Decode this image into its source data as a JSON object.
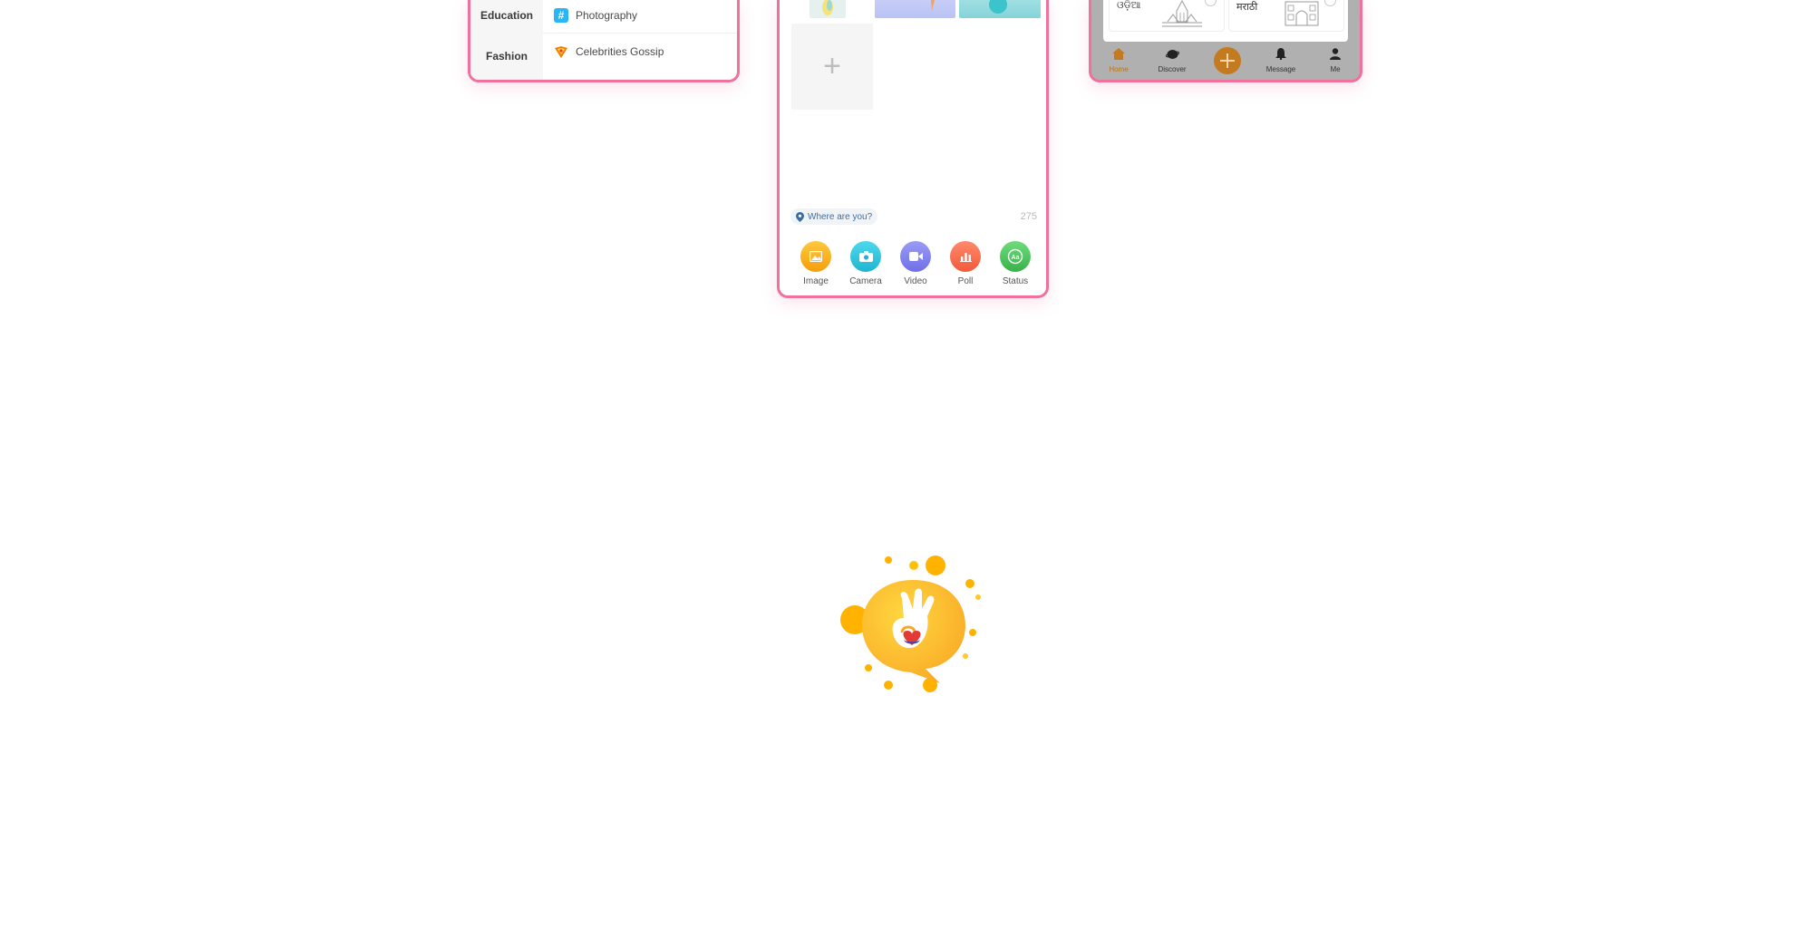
{
  "left_panel": {
    "categories": [
      {
        "label": "Education"
      },
      {
        "label": "Fashion"
      }
    ],
    "topics": [
      {
        "label": "Photography",
        "icon": "hashtag-icon"
      },
      {
        "label": "Celebrities Gossip",
        "icon": "gossip-icon"
      }
    ]
  },
  "composer": {
    "add_media_symbol": "+",
    "location_placeholder": "Where are you?",
    "char_count": "275",
    "tools": [
      {
        "label": "Image",
        "icon": "image-icon",
        "color": "#f9a825"
      },
      {
        "label": "Camera",
        "icon": "camera-icon",
        "color": "#26c6da"
      },
      {
        "label": "Video",
        "icon": "video-icon",
        "color": "#7e7ff0"
      },
      {
        "label": "Poll",
        "icon": "poll-icon",
        "color": "#f8684c"
      },
      {
        "label": "Status",
        "icon": "status-icon",
        "color": "#4cc35a"
      }
    ]
  },
  "language_panel": {
    "languages": [
      {
        "label": "ଓଡ଼ିଆ"
      },
      {
        "label": "मराठी"
      }
    ],
    "tabs": [
      {
        "label": "Home",
        "icon": "home-icon",
        "active": true
      },
      {
        "label": "Discover",
        "icon": "discover-icon",
        "active": false
      },
      {
        "label": "Message",
        "icon": "bell-icon",
        "active": false
      },
      {
        "label": "Me",
        "icon": "person-icon",
        "active": false
      }
    ],
    "accent": "#c47a1f"
  },
  "colors": {
    "frame_border": "#f0719a",
    "logo_yellow": "#ffb300"
  }
}
